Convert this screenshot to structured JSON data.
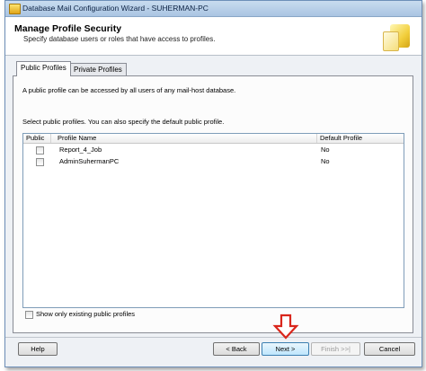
{
  "window": {
    "title": "Database Mail Configuration Wizard - SUHERMAN-PC"
  },
  "header": {
    "title": "Manage Profile Security",
    "subtitle": "Specify database users or roles that have access to profiles."
  },
  "tabs": [
    {
      "label": "Public Profiles",
      "active": true
    },
    {
      "label": "Private Profiles",
      "active": false
    }
  ],
  "panel": {
    "description": "A public profile can be accessed by all users of any mail-host database.",
    "instruction": "Select public profiles. You can also specify the default public profile."
  },
  "grid": {
    "columns": [
      "Public",
      "Profile Name",
      "Default Profile"
    ],
    "rows": [
      {
        "public": false,
        "profile_name": "Report_4_Job",
        "default_profile": "No"
      },
      {
        "public": false,
        "profile_name": "AdminSuhermanPC",
        "default_profile": "No"
      }
    ]
  },
  "show_only": {
    "label": "Show only existing public profiles",
    "checked": false
  },
  "buttons": {
    "help": "Help",
    "back": "< Back",
    "next": "Next >",
    "finish": "Finish >>|",
    "cancel": "Cancel"
  },
  "colors": {
    "annotation_arrow": "#d9261c",
    "titlebar": "#b9d1ea",
    "primary_button": "#bee6fd"
  },
  "icons": [
    "app-icon",
    "wizard-icon",
    "down-arrow-icon"
  ]
}
